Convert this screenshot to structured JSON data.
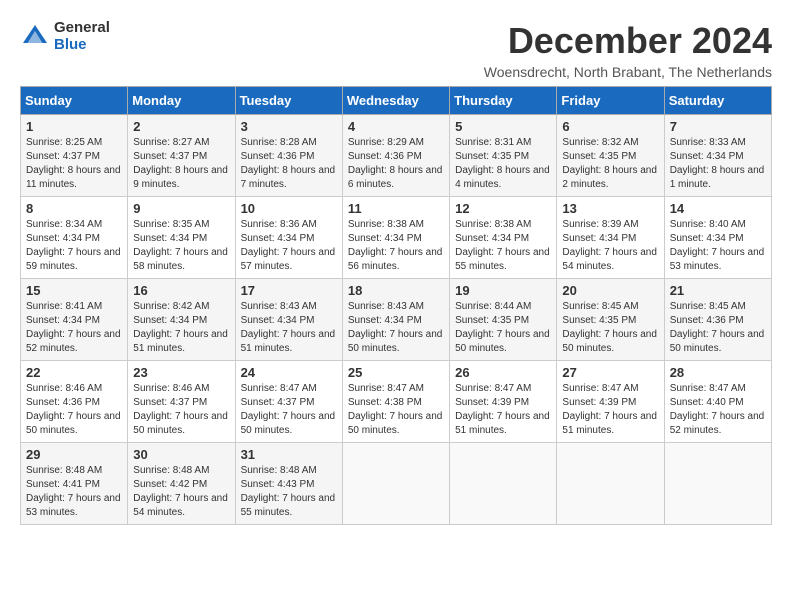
{
  "header": {
    "logo_general": "General",
    "logo_blue": "Blue",
    "month_title": "December 2024",
    "subtitle": "Woensdrecht, North Brabant, The Netherlands"
  },
  "days_of_week": [
    "Sunday",
    "Monday",
    "Tuesday",
    "Wednesday",
    "Thursday",
    "Friday",
    "Saturday"
  ],
  "weeks": [
    [
      {
        "day": "1",
        "sunrise": "8:25 AM",
        "sunset": "4:37 PM",
        "daylight": "8 hours and 11 minutes."
      },
      {
        "day": "2",
        "sunrise": "8:27 AM",
        "sunset": "4:37 PM",
        "daylight": "8 hours and 9 minutes."
      },
      {
        "day": "3",
        "sunrise": "8:28 AM",
        "sunset": "4:36 PM",
        "daylight": "8 hours and 7 minutes."
      },
      {
        "day": "4",
        "sunrise": "8:29 AM",
        "sunset": "4:36 PM",
        "daylight": "8 hours and 6 minutes."
      },
      {
        "day": "5",
        "sunrise": "8:31 AM",
        "sunset": "4:35 PM",
        "daylight": "8 hours and 4 minutes."
      },
      {
        "day": "6",
        "sunrise": "8:32 AM",
        "sunset": "4:35 PM",
        "daylight": "8 hours and 2 minutes."
      },
      {
        "day": "7",
        "sunrise": "8:33 AM",
        "sunset": "4:34 PM",
        "daylight": "8 hours and 1 minute."
      }
    ],
    [
      {
        "day": "8",
        "sunrise": "8:34 AM",
        "sunset": "4:34 PM",
        "daylight": "7 hours and 59 minutes."
      },
      {
        "day": "9",
        "sunrise": "8:35 AM",
        "sunset": "4:34 PM",
        "daylight": "7 hours and 58 minutes."
      },
      {
        "day": "10",
        "sunrise": "8:36 AM",
        "sunset": "4:34 PM",
        "daylight": "7 hours and 57 minutes."
      },
      {
        "day": "11",
        "sunrise": "8:38 AM",
        "sunset": "4:34 PM",
        "daylight": "7 hours and 56 minutes."
      },
      {
        "day": "12",
        "sunrise": "8:38 AM",
        "sunset": "4:34 PM",
        "daylight": "7 hours and 55 minutes."
      },
      {
        "day": "13",
        "sunrise": "8:39 AM",
        "sunset": "4:34 PM",
        "daylight": "7 hours and 54 minutes."
      },
      {
        "day": "14",
        "sunrise": "8:40 AM",
        "sunset": "4:34 PM",
        "daylight": "7 hours and 53 minutes."
      }
    ],
    [
      {
        "day": "15",
        "sunrise": "8:41 AM",
        "sunset": "4:34 PM",
        "daylight": "7 hours and 52 minutes."
      },
      {
        "day": "16",
        "sunrise": "8:42 AM",
        "sunset": "4:34 PM",
        "daylight": "7 hours and 51 minutes."
      },
      {
        "day": "17",
        "sunrise": "8:43 AM",
        "sunset": "4:34 PM",
        "daylight": "7 hours and 51 minutes."
      },
      {
        "day": "18",
        "sunrise": "8:43 AM",
        "sunset": "4:34 PM",
        "daylight": "7 hours and 50 minutes."
      },
      {
        "day": "19",
        "sunrise": "8:44 AM",
        "sunset": "4:35 PM",
        "daylight": "7 hours and 50 minutes."
      },
      {
        "day": "20",
        "sunrise": "8:45 AM",
        "sunset": "4:35 PM",
        "daylight": "7 hours and 50 minutes."
      },
      {
        "day": "21",
        "sunrise": "8:45 AM",
        "sunset": "4:36 PM",
        "daylight": "7 hours and 50 minutes."
      }
    ],
    [
      {
        "day": "22",
        "sunrise": "8:46 AM",
        "sunset": "4:36 PM",
        "daylight": "7 hours and 50 minutes."
      },
      {
        "day": "23",
        "sunrise": "8:46 AM",
        "sunset": "4:37 PM",
        "daylight": "7 hours and 50 minutes."
      },
      {
        "day": "24",
        "sunrise": "8:47 AM",
        "sunset": "4:37 PM",
        "daylight": "7 hours and 50 minutes."
      },
      {
        "day": "25",
        "sunrise": "8:47 AM",
        "sunset": "4:38 PM",
        "daylight": "7 hours and 50 minutes."
      },
      {
        "day": "26",
        "sunrise": "8:47 AM",
        "sunset": "4:39 PM",
        "daylight": "7 hours and 51 minutes."
      },
      {
        "day": "27",
        "sunrise": "8:47 AM",
        "sunset": "4:39 PM",
        "daylight": "7 hours and 51 minutes."
      },
      {
        "day": "28",
        "sunrise": "8:47 AM",
        "sunset": "4:40 PM",
        "daylight": "7 hours and 52 minutes."
      }
    ],
    [
      {
        "day": "29",
        "sunrise": "8:48 AM",
        "sunset": "4:41 PM",
        "daylight": "7 hours and 53 minutes."
      },
      {
        "day": "30",
        "sunrise": "8:48 AM",
        "sunset": "4:42 PM",
        "daylight": "7 hours and 54 minutes."
      },
      {
        "day": "31",
        "sunrise": "8:48 AM",
        "sunset": "4:43 PM",
        "daylight": "7 hours and 55 minutes."
      },
      null,
      null,
      null,
      null
    ]
  ]
}
